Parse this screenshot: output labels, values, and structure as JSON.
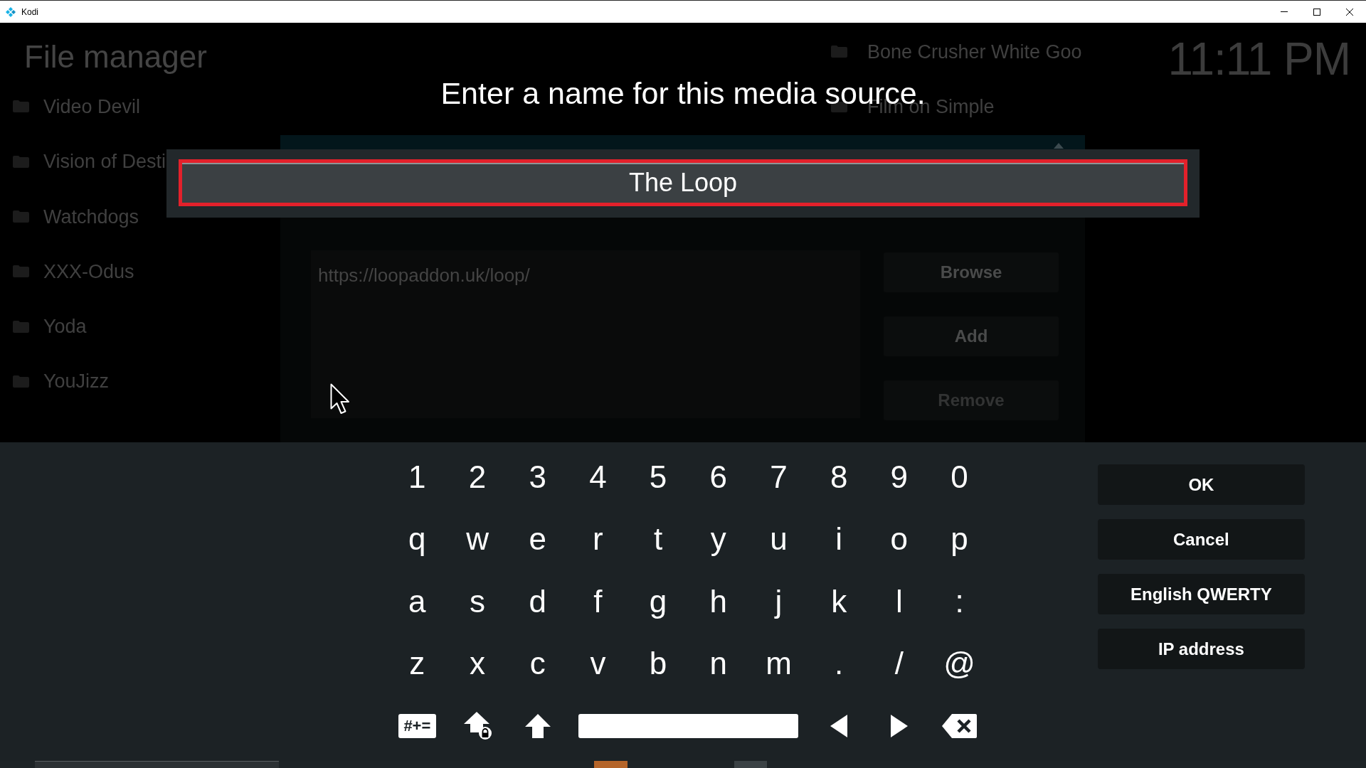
{
  "window": {
    "title": "Kodi"
  },
  "file_manager": {
    "title": "File manager",
    "left_sources": [
      "Video Devil",
      "Vision of Desti",
      "Watchdogs",
      "XXX-Odus",
      "Yoda",
      "YouJizz"
    ],
    "right_sources": [
      "Bone Crusher White Goo",
      "Film on Simple"
    ],
    "clock": "11:11 PM"
  },
  "add_source_dialog": {
    "path": "https://loopaddon.uk/loop/",
    "buttons": [
      {
        "label": "Browse",
        "disabled": false
      },
      {
        "label": "Add",
        "disabled": false
      },
      {
        "label": "Remove",
        "disabled": true
      }
    ]
  },
  "keyboard": {
    "heading": "Enter a name for this media source.",
    "input": {
      "value": "The Loop",
      "focused": true
    },
    "key_rows": [
      [
        "1",
        "2",
        "3",
        "4",
        "5",
        "6",
        "7",
        "8",
        "9",
        "0"
      ],
      [
        "q",
        "w",
        "e",
        "r",
        "t",
        "y",
        "u",
        "i",
        "o",
        "p"
      ],
      [
        "a",
        "s",
        "d",
        "f",
        "g",
        "h",
        "j",
        "k",
        "l",
        ":"
      ],
      [
        "z",
        "x",
        "c",
        "v",
        "b",
        "n",
        "m",
        ".",
        "/",
        "@"
      ]
    ],
    "function_keys": [
      {
        "kind": "symbols",
        "label": "#+="
      },
      {
        "kind": "caps_lock"
      },
      {
        "kind": "shift"
      },
      {
        "kind": "space"
      },
      {
        "kind": "left"
      },
      {
        "kind": "right"
      },
      {
        "kind": "backspace"
      }
    ],
    "buttons": [
      {
        "label": "OK"
      },
      {
        "label": "Cancel"
      },
      {
        "label": "English QWERTY"
      },
      {
        "label": "IP address"
      }
    ]
  }
}
